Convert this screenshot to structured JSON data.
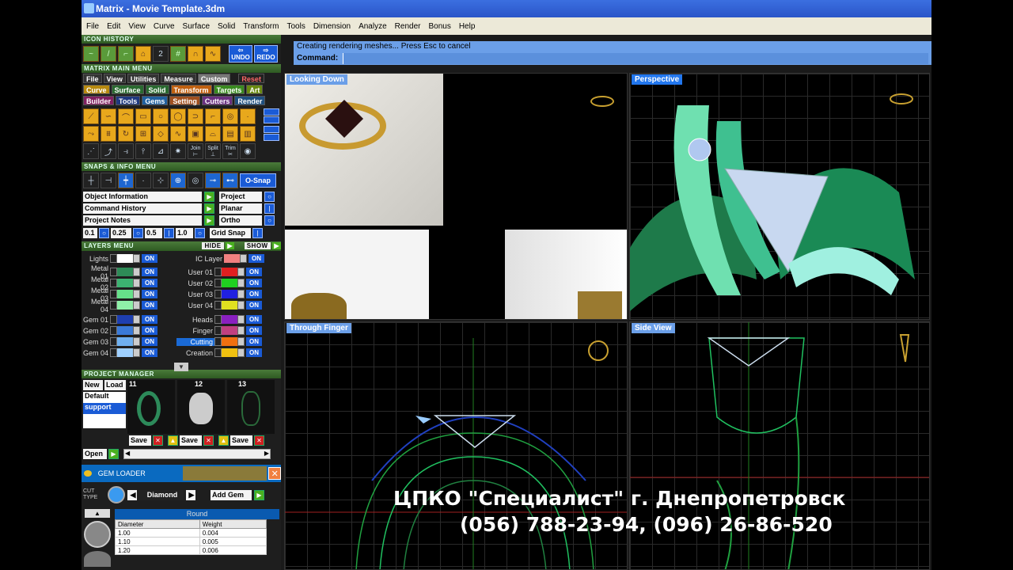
{
  "window": {
    "title": "Matrix - Movie Template.3dm"
  },
  "menu": [
    "File",
    "Edit",
    "View",
    "Curve",
    "Surface",
    "Solid",
    "Transform",
    "Tools",
    "Dimension",
    "Analyze",
    "Render",
    "Bonus",
    "Help"
  ],
  "icon_history": {
    "header": "ICON HISTORY",
    "undo": "UNDO",
    "redo": "REDO",
    "counter": "2"
  },
  "main_menu": {
    "header": "MATRIX MAIN MENU",
    "row1": [
      "File",
      "View",
      "Utilities",
      "Measure",
      "Custom",
      "Reset"
    ],
    "row2": [
      "Curve",
      "Surface",
      "Solid",
      "Transform",
      "Targets",
      "Art"
    ],
    "row3": [
      "Builder",
      "Tools",
      "Gems",
      "Setting",
      "Cutters",
      "Render"
    ],
    "tool_labels": [
      "Join",
      "Split",
      "Trim"
    ]
  },
  "snaps": {
    "header": "SNAPS & INFO MENU",
    "osnap": "O-Snap",
    "items": [
      "Object Information",
      "Command History",
      "Project Notes"
    ],
    "right_items": [
      "Project",
      "Planar",
      "Ortho"
    ],
    "values": [
      "0.1",
      "0.25",
      "0.5",
      "1.0"
    ],
    "grid_snap": "Grid Snap"
  },
  "layers": {
    "header": "LAYERS MENU",
    "hide": "HIDE",
    "show": "SHOW",
    "on_label": "ON",
    "lights": "Lights",
    "ic_layer": "IC Layer",
    "left": [
      "Metal 01",
      "Metal 02",
      "Metal 03",
      "Metal 04",
      "Gem 01",
      "Gem 02",
      "Gem 03",
      "Gem 04"
    ],
    "right": [
      "User 01",
      "User 02",
      "User 03",
      "User 04",
      "Heads",
      "Finger",
      "Cutting",
      "Creation"
    ],
    "colors": {
      "metal": [
        "#2e8b57",
        "#3cb371",
        "#66e08a",
        "#8ff0a8"
      ],
      "gem": [
        "#1e3fb0",
        "#3a7ad8",
        "#6fb0f0",
        "#9fd0ff"
      ],
      "user": [
        "#e02020",
        "#20d020",
        "#2020e0",
        "#e0e020"
      ],
      "extra": [
        "#8a20c0",
        "#c04080",
        "#f07010",
        "#f0c010"
      ]
    }
  },
  "project_manager": {
    "header": "PROJECT MANAGER",
    "new": "New",
    "load": "Load",
    "list": [
      "Default",
      "support"
    ],
    "thumbs": [
      "11",
      "12",
      "13"
    ],
    "save": "Save",
    "open": "Open"
  },
  "gem_loader": {
    "header": "GEM LOADER",
    "cut_type": "CUT TYPE",
    "cut": "Diamond",
    "add_gem": "Add Gem",
    "shape": "Round",
    "columns": [
      "Diameter",
      "Weight"
    ],
    "rows": [
      [
        "1.00",
        "0.004"
      ],
      [
        "1.10",
        "0.005"
      ],
      [
        "1.20",
        "0.006"
      ]
    ]
  },
  "command": {
    "history": "Creating rendering meshes... Press Esc to cancel",
    "label": "Command:"
  },
  "viewports": [
    "Looking Down",
    "Perspective",
    "Through Finger",
    "Side View"
  ],
  "overlay": {
    "line1": "ЦПКО \"Специалист\" г. Днепропетровск",
    "line2": "(056) 788-23-94, (096) 26-86-520"
  }
}
